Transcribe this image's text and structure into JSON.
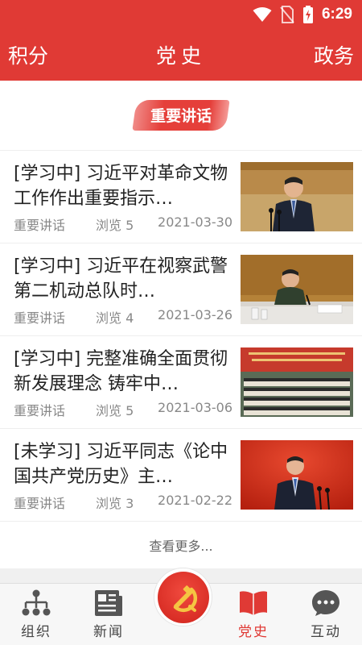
{
  "status": {
    "time": "6:29"
  },
  "header": {
    "left": "积分",
    "title": "党史",
    "right": "政务"
  },
  "section": {
    "tag": "重要讲话"
  },
  "articles": [
    {
      "title": "[学习中] 习近平对革命文物工作作出重要指示…",
      "category": "重要讲话",
      "views": "浏览 5",
      "date": "2021-03-30"
    },
    {
      "title": "[学习中] 习近平在视察武警第二机动总队时…",
      "category": "重要讲话",
      "views": "浏览 4",
      "date": "2021-03-26"
    },
    {
      "title": "[学习中] 完整准确全面贯彻新发展理念 铸牢中…",
      "category": "重要讲话",
      "views": "浏览 5",
      "date": "2021-03-06"
    },
    {
      "title": "[未学习] 习近平同志《论中国共产党历史》主…",
      "category": "重要讲话",
      "views": "浏览 3",
      "date": "2021-02-22"
    }
  ],
  "more": "查看更多...",
  "tabs": [
    {
      "label": "组织",
      "icon": "org-chart-icon"
    },
    {
      "label": "新闻",
      "icon": "newspaper-icon"
    },
    {
      "label": "",
      "icon": "party-emblem-icon"
    },
    {
      "label": "党史",
      "icon": "book-icon"
    },
    {
      "label": "互动",
      "icon": "chat-bubble-icon"
    }
  ],
  "colors": {
    "brand": "#e03a35",
    "active_tab": "#e03a35"
  }
}
